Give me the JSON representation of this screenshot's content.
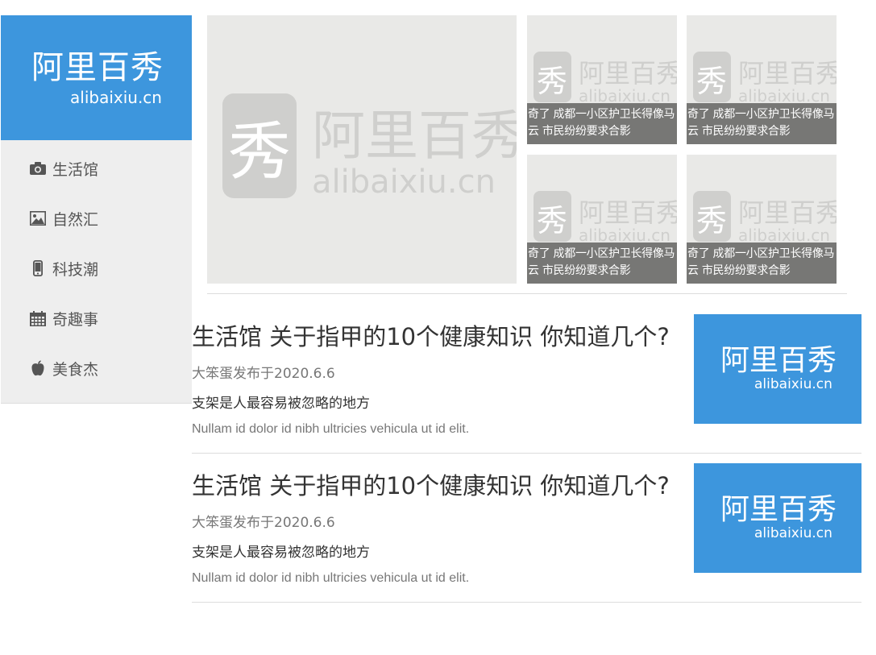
{
  "logo": {
    "zh": "阿里百秀",
    "en": "alibaixiu.cn"
  },
  "nav": [
    {
      "label": "生活馆",
      "icon": "camera-icon"
    },
    {
      "label": "自然汇",
      "icon": "picture-icon"
    },
    {
      "label": "科技潮",
      "icon": "phone-icon"
    },
    {
      "label": "奇趣事",
      "icon": "calendar-icon"
    },
    {
      "label": "美食杰",
      "icon": "apple-icon"
    }
  ],
  "carousel": {
    "watermark_zh": "阿里百秀",
    "watermark_en": "alibaixiu.cn",
    "watermark_glyph": "秀"
  },
  "tiles": [
    {
      "caption": "奇了 成都一小区护卫长得像马云 市民纷纷要求合影"
    },
    {
      "caption": "奇了 成都一小区护卫长得像马云 市民纷纷要求合影"
    },
    {
      "caption": "奇了 成都一小区护卫长得像马云 市民纷纷要求合影"
    },
    {
      "caption": "奇了 成都一小区护卫长得像马云 市民纷纷要求合影"
    }
  ],
  "articles": [
    {
      "title": "生活馆 关于指甲的10个健康知识 你知道几个?",
      "meta": "大笨蛋发布于2020.6.6",
      "summary": "支架是人最容易被忽略的地方",
      "excerpt": "Nullam id dolor id nibh ultricies vehicula ut id elit.",
      "thumb_zh": "阿里百秀",
      "thumb_en": "alibaixiu.cn"
    },
    {
      "title": "生活馆 关于指甲的10个健康知识 你知道几个?",
      "meta": "大笨蛋发布于2020.6.6",
      "summary": "支架是人最容易被忽略的地方",
      "excerpt": "Nullam id dolor id nibh ultricies vehicula ut id elit.",
      "thumb_zh": "阿里百秀",
      "thumb_en": "alibaixiu.cn"
    }
  ],
  "colors": {
    "brand": "#3d96dd",
    "sidebar_bg": "#eeeeee",
    "caption_bg": "#777775"
  }
}
